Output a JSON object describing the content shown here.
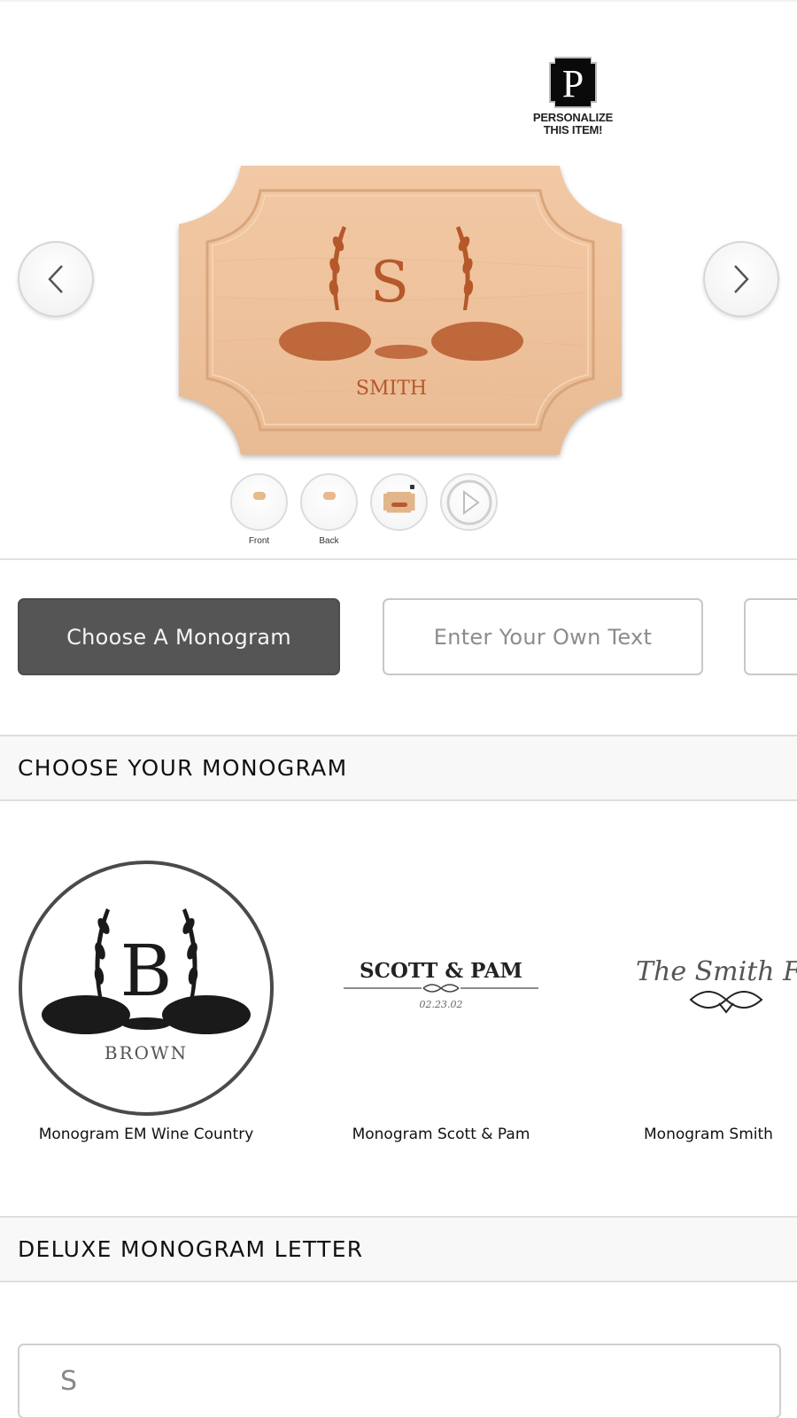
{
  "personalize": {
    "badge_letter": "P",
    "line1": "PERSONALIZE",
    "line2": "THIS ITEM!"
  },
  "carousel": {
    "prev_icon": "chevron-left-icon",
    "next_icon": "chevron-right-icon"
  },
  "product_preview": {
    "engraved_letter": "S",
    "engraved_name": "SMITH",
    "wood_color": "#eec4a0",
    "engrave_color": "#b5582a"
  },
  "thumbnails": [
    {
      "label": "Front",
      "type": "image"
    },
    {
      "label": "Back",
      "type": "image"
    },
    {
      "label": "",
      "type": "personalized-preview"
    },
    {
      "label": "",
      "type": "video",
      "icon": "play-icon"
    }
  ],
  "tabs": [
    {
      "label": "Choose A Monogram",
      "active": true
    },
    {
      "label": "Enter Your Own Text",
      "active": false
    },
    {
      "label": "",
      "active": false
    }
  ],
  "sections": {
    "choose_monogram": "CHOOSE YOUR MONOGRAM",
    "deluxe_letter": "DELUXE MONOGRAM LETTER"
  },
  "monograms": [
    {
      "label": "Monogram EM Wine Country",
      "preview_letter": "B",
      "preview_name": "BROWN",
      "selected": true
    },
    {
      "label": "Monogram Scott & Pam",
      "preview_title": "SCOTT & PAM",
      "preview_date": "02.23.02",
      "selected": false
    },
    {
      "label": "Monogram Smith",
      "preview_title": "The Smith F",
      "selected": false
    }
  ],
  "letter_input": {
    "value": "S"
  },
  "colors": {
    "active_tab": "#555555",
    "section_bg": "#f8f8f8",
    "border": "#dedede"
  }
}
